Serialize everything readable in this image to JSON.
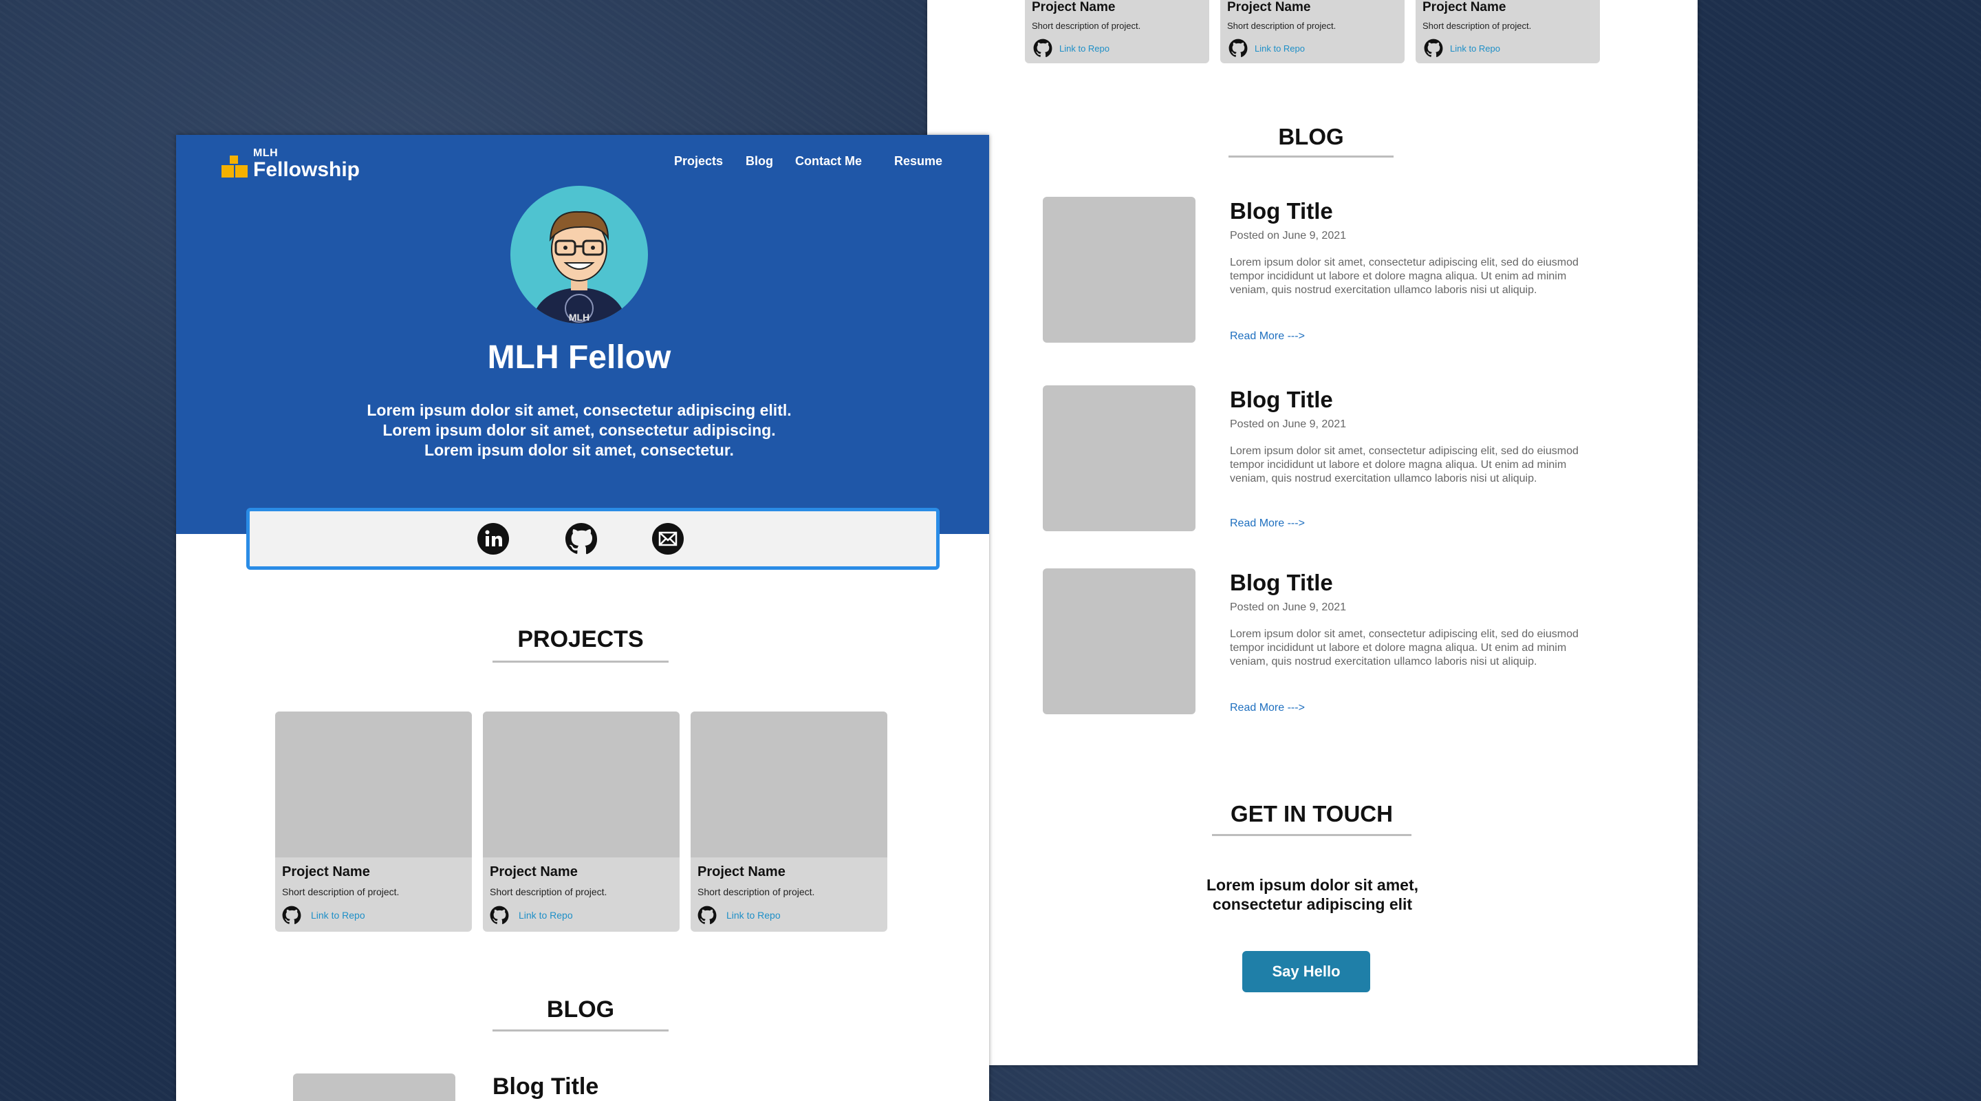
{
  "brand": {
    "small": "MLH",
    "name": "Fellowship",
    "accent": "#f5b100"
  },
  "nav": {
    "projects": "Projects",
    "blog": "Blog",
    "contact": "Contact Me",
    "resume": "Resume"
  },
  "hero": {
    "name": "MLH Fellow",
    "bio": [
      "Lorem ipsum dolor sit amet, consectetur adipiscing elitl.",
      "Lorem ipsum dolor sit amet, consectetur adipiscing.",
      "Lorem ipsum dolor sit amet, consectetur."
    ],
    "avatar_shirt_text": "MLH",
    "background": "#1f57a8"
  },
  "social": {
    "icons": [
      "linkedin-icon",
      "github-icon",
      "email-icon"
    ]
  },
  "sections": {
    "projects": "PROJECTS",
    "blog": "BLOG",
    "contact": "GET IN TOUCH"
  },
  "projects": [
    {
      "name": "Project Name",
      "desc": "Short description of project.",
      "link": "Link to Repo"
    },
    {
      "name": "Project Name",
      "desc": "Short description of project.",
      "link": "Link to Repo"
    },
    {
      "name": "Project Name",
      "desc": "Short description of project.",
      "link": "Link to Repo"
    }
  ],
  "blog": [
    {
      "title": "Blog Title",
      "date": "Posted on June 9, 2021",
      "text": "Lorem ipsum dolor sit amet, consectetur adipiscing elit, sed do eiusmod tempor incididunt ut labore et dolore magna aliqua. Ut enim ad minim veniam, quis nostrud exercitation ullamco laboris nisi ut aliquip.",
      "more": "Read More --->"
    },
    {
      "title": "Blog Title",
      "date": "Posted on June 9, 2021",
      "text": "Lorem ipsum dolor sit amet, consectetur adipiscing elit, sed do eiusmod tempor incididunt ut labore et dolore magna aliqua. Ut enim ad minim veniam, quis nostrud exercitation ullamco laboris nisi ut aliquip.",
      "more": "Read More --->"
    },
    {
      "title": "Blog Title",
      "date": "Posted on June 9, 2021",
      "text": "Lorem ipsum dolor sit amet, consectetur adipiscing elit, sed do eiusmod tempor incididunt ut labore et dolore magna aliqua. Ut enim ad minim veniam, quis nostrud exercitation ullamco laboris nisi ut aliquip.",
      "more": "Read More --->"
    }
  ],
  "left_blog_title": "Blog Title",
  "contact": {
    "text": [
      "Lorem ipsum dolor sit amet,",
      "consectetur adipiscing elit"
    ],
    "button": "Say Hello",
    "button_color": "#1f7fa8"
  }
}
